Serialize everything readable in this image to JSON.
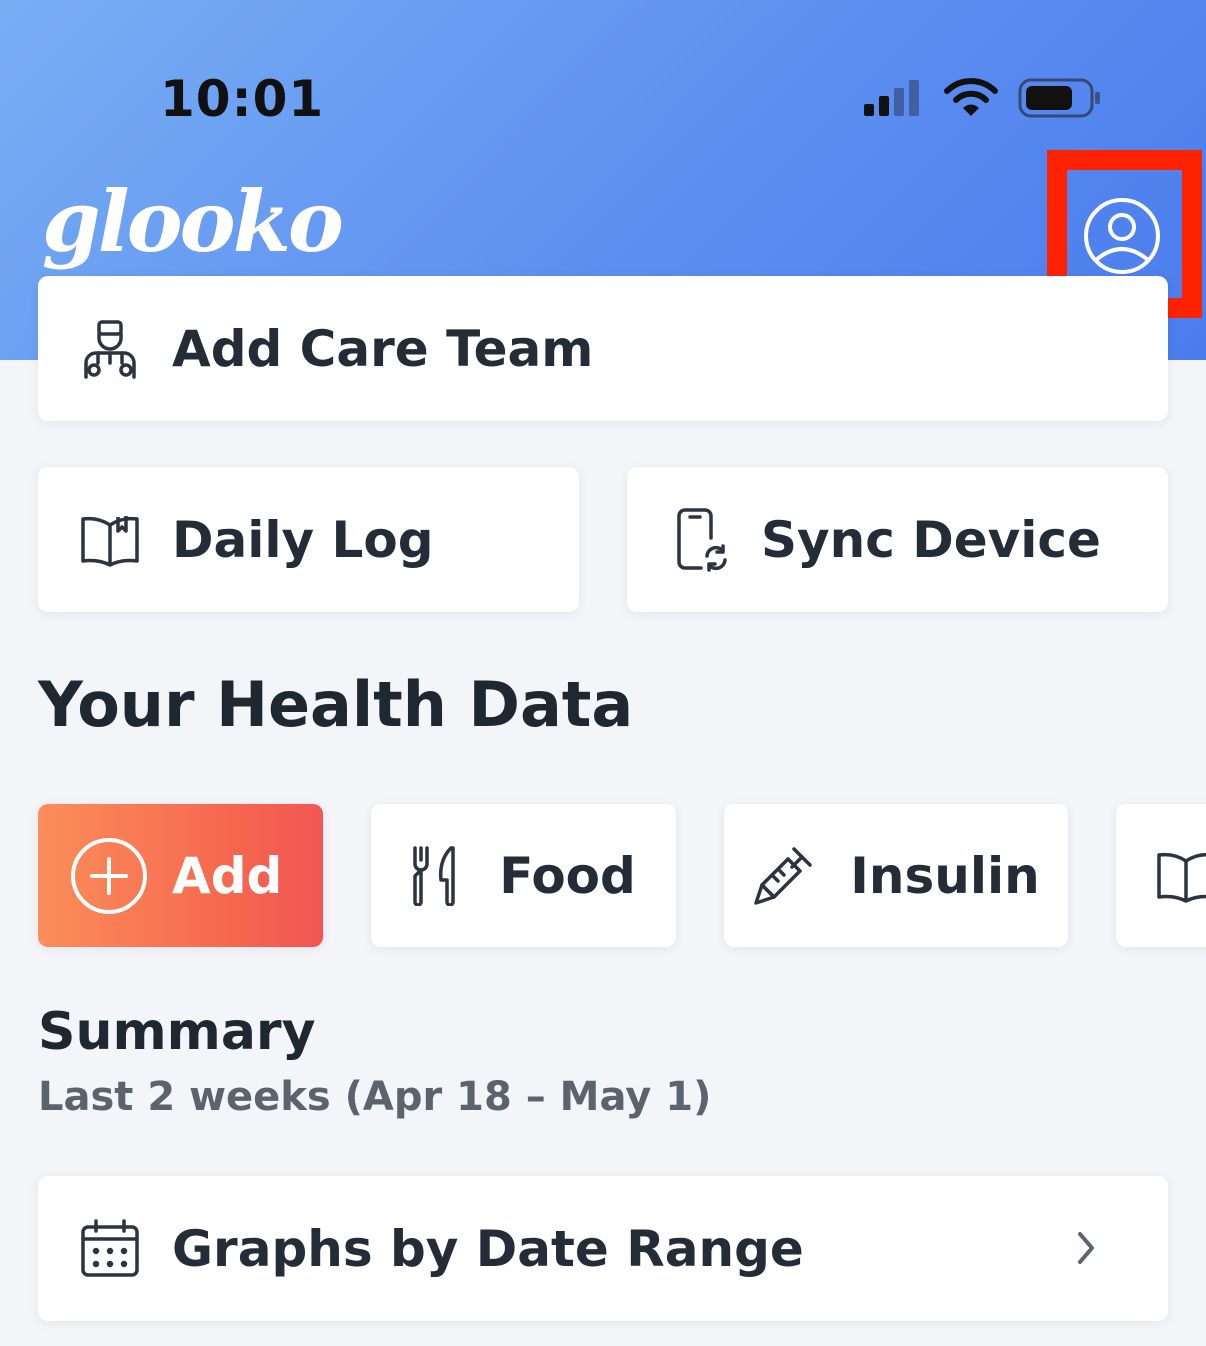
{
  "status_bar": {
    "time": "10:01"
  },
  "header": {
    "logo_text": "glooko",
    "profile_icon": "user-circle-icon"
  },
  "actions": {
    "care_team": {
      "label": "Add Care Team",
      "icon": "doctor-icon"
    },
    "daily_log": {
      "label": "Daily Log",
      "icon": "book-icon"
    },
    "sync_device": {
      "label": "Sync Device",
      "icon": "device-sync-icon"
    }
  },
  "health": {
    "title": "Your Health Data",
    "chips": [
      {
        "label": "Add",
        "icon": "plus-circle-icon"
      },
      {
        "label": "Food",
        "icon": "fork-knife-icon"
      },
      {
        "label": "Insulin",
        "icon": "syringe-icon"
      },
      {
        "label": "",
        "icon": "book-icon"
      }
    ]
  },
  "summary": {
    "title": "Summary",
    "subtitle": "Last 2 weeks (Apr 18 – May 1)"
  },
  "graphs": {
    "label": "Graphs by Date Range",
    "icon": "calendar-icon"
  },
  "colors": {
    "header_start": "#78aef4",
    "header_end": "#4a7cee",
    "add_start": "#fb8e5a",
    "add_end": "#f25555",
    "highlight": "#ff2200",
    "text_dark": "#232c37"
  }
}
